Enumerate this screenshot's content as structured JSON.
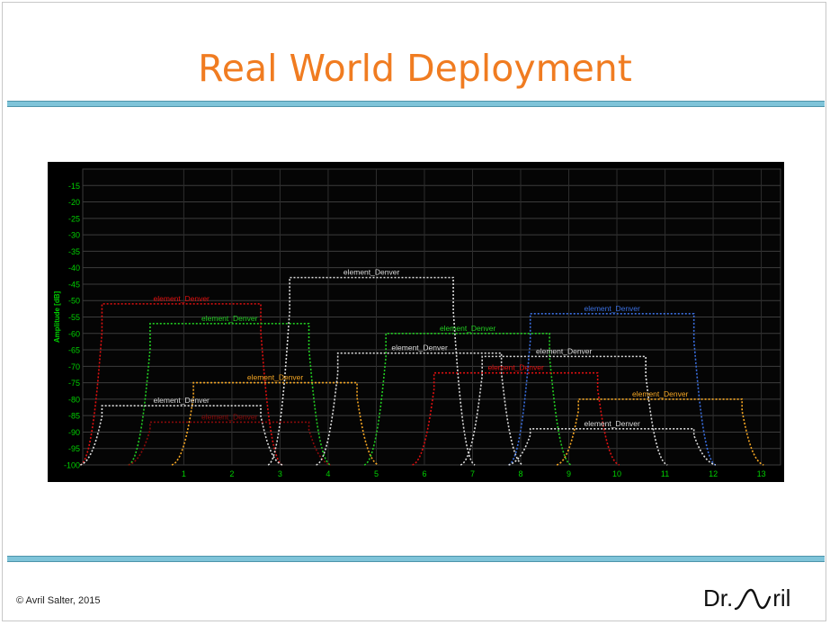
{
  "slide": {
    "title": "Real World Deployment",
    "footer": "© Avril Salter, 2015",
    "logo_prefix": "Dr.",
    "logo_suffix": "ril"
  },
  "colors": {
    "title": "#f07c21",
    "rule": "#7fc4d9",
    "axis_text": "#00d000",
    "red": "#e01010",
    "green": "#22cc22",
    "white": "#dddddd",
    "orange": "#f5a623",
    "blue": "#3a6fe0",
    "dark_red": "#8a0a0a"
  },
  "chart_data": {
    "type": "line",
    "ylabel": "Amplitude [dB]",
    "xlabel": "",
    "ylim": [
      -100,
      -10
    ],
    "xlim": [
      -1.1,
      13.4
    ],
    "yticks": [
      -15,
      -20,
      -25,
      -30,
      -35,
      -40,
      -45,
      -50,
      -55,
      -60,
      -65,
      -70,
      -75,
      -80,
      -85,
      -90,
      -95,
      -100
    ],
    "xticks": [
      1,
      2,
      3,
      4,
      5,
      6,
      7,
      8,
      9,
      10,
      11,
      12,
      13
    ],
    "grid": true,
    "legend": "none",
    "series": [
      {
        "name": "element_Denver",
        "color": "red",
        "left": -0.7,
        "right": 2.6,
        "top": -51
      },
      {
        "name": "element_Denver",
        "color": "green",
        "left": 0.3,
        "right": 3.6,
        "top": -57
      },
      {
        "name": "element_Denver",
        "color": "white",
        "left": 3.2,
        "right": 6.6,
        "top": -43
      },
      {
        "name": "element_Denver",
        "color": "orange",
        "left": 1.2,
        "right": 4.6,
        "top": -75
      },
      {
        "name": "element_Denver",
        "color": "white",
        "left": -0.7,
        "right": 2.6,
        "top": -82
      },
      {
        "name": "element_Denver",
        "color": "dark_red",
        "left": 0.3,
        "right": 3.6,
        "top": -87
      },
      {
        "name": "element_Denver",
        "color": "white",
        "left": 4.2,
        "right": 7.6,
        "top": -66
      },
      {
        "name": "element_Denver",
        "color": "green",
        "left": 5.2,
        "right": 8.6,
        "top": -60
      },
      {
        "name": "element_Denver",
        "color": "red",
        "left": 6.2,
        "right": 9.6,
        "top": -72
      },
      {
        "name": "element_Denver",
        "color": "white",
        "left": 7.2,
        "right": 10.6,
        "top": -67
      },
      {
        "name": "element_Denver",
        "color": "blue",
        "left": 8.2,
        "right": 11.6,
        "top": -54
      },
      {
        "name": "element_Denver",
        "color": "orange",
        "left": 9.2,
        "right": 12.6,
        "top": -80
      },
      {
        "name": "element_Denver",
        "color": "white",
        "left": 8.2,
        "right": 11.6,
        "top": -89
      }
    ]
  }
}
